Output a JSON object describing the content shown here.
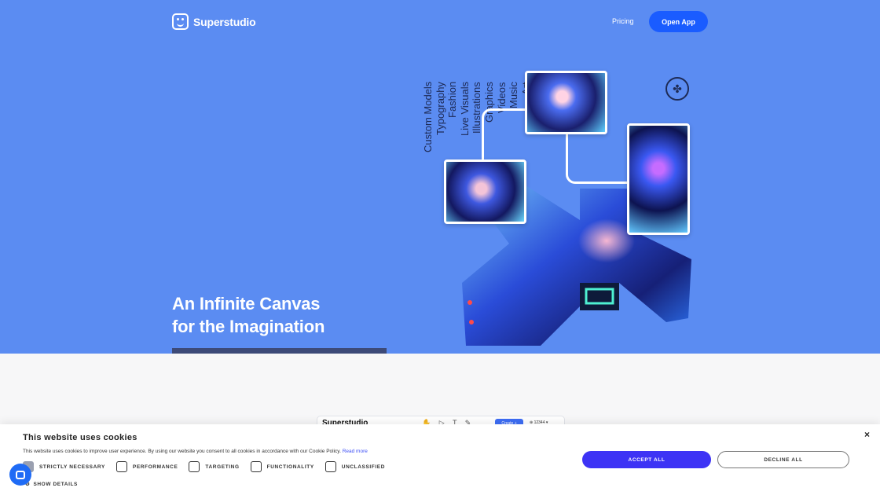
{
  "header": {
    "brand": "Superstudio",
    "nav_pricing": "Pricing",
    "open_app": "Open App"
  },
  "hero": {
    "headline_line1": "An Infinite Canvas",
    "headline_line2": "for the Imagination",
    "words": [
      "Custom Models",
      "Typography",
      "Fashion",
      "Live Visuals",
      "Illustrations",
      "Graphics",
      "Videos",
      "Music",
      "Art"
    ]
  },
  "preview": {
    "brand": "Superstudio",
    "tools": "✋ ▷ T ✎",
    "create": "Create +",
    "credits": "⊕ 12344 ▾"
  },
  "cookie": {
    "title": "This website uses cookies",
    "description": "This website uses cookies to improve user experience. By using our website you consent to all cookies in accordance with our Cookie Policy.",
    "read_more": "Read more",
    "options": [
      {
        "label": "STRICTLY NECESSARY",
        "checked": true
      },
      {
        "label": "PERFORMANCE",
        "checked": false
      },
      {
        "label": "TARGETING",
        "checked": false
      },
      {
        "label": "FUNCTIONALITY",
        "checked": false
      },
      {
        "label": "UNCLASSIFIED",
        "checked": false
      }
    ],
    "show_details": "SHOW DETAILS",
    "accept": "ACCEPT ALL",
    "decline": "DECLINE ALL",
    "close": "×"
  },
  "colors": {
    "hero_bg": "#5b8cf2",
    "primary_button": "#1a5cff",
    "accept_button": "#3d33f5"
  }
}
